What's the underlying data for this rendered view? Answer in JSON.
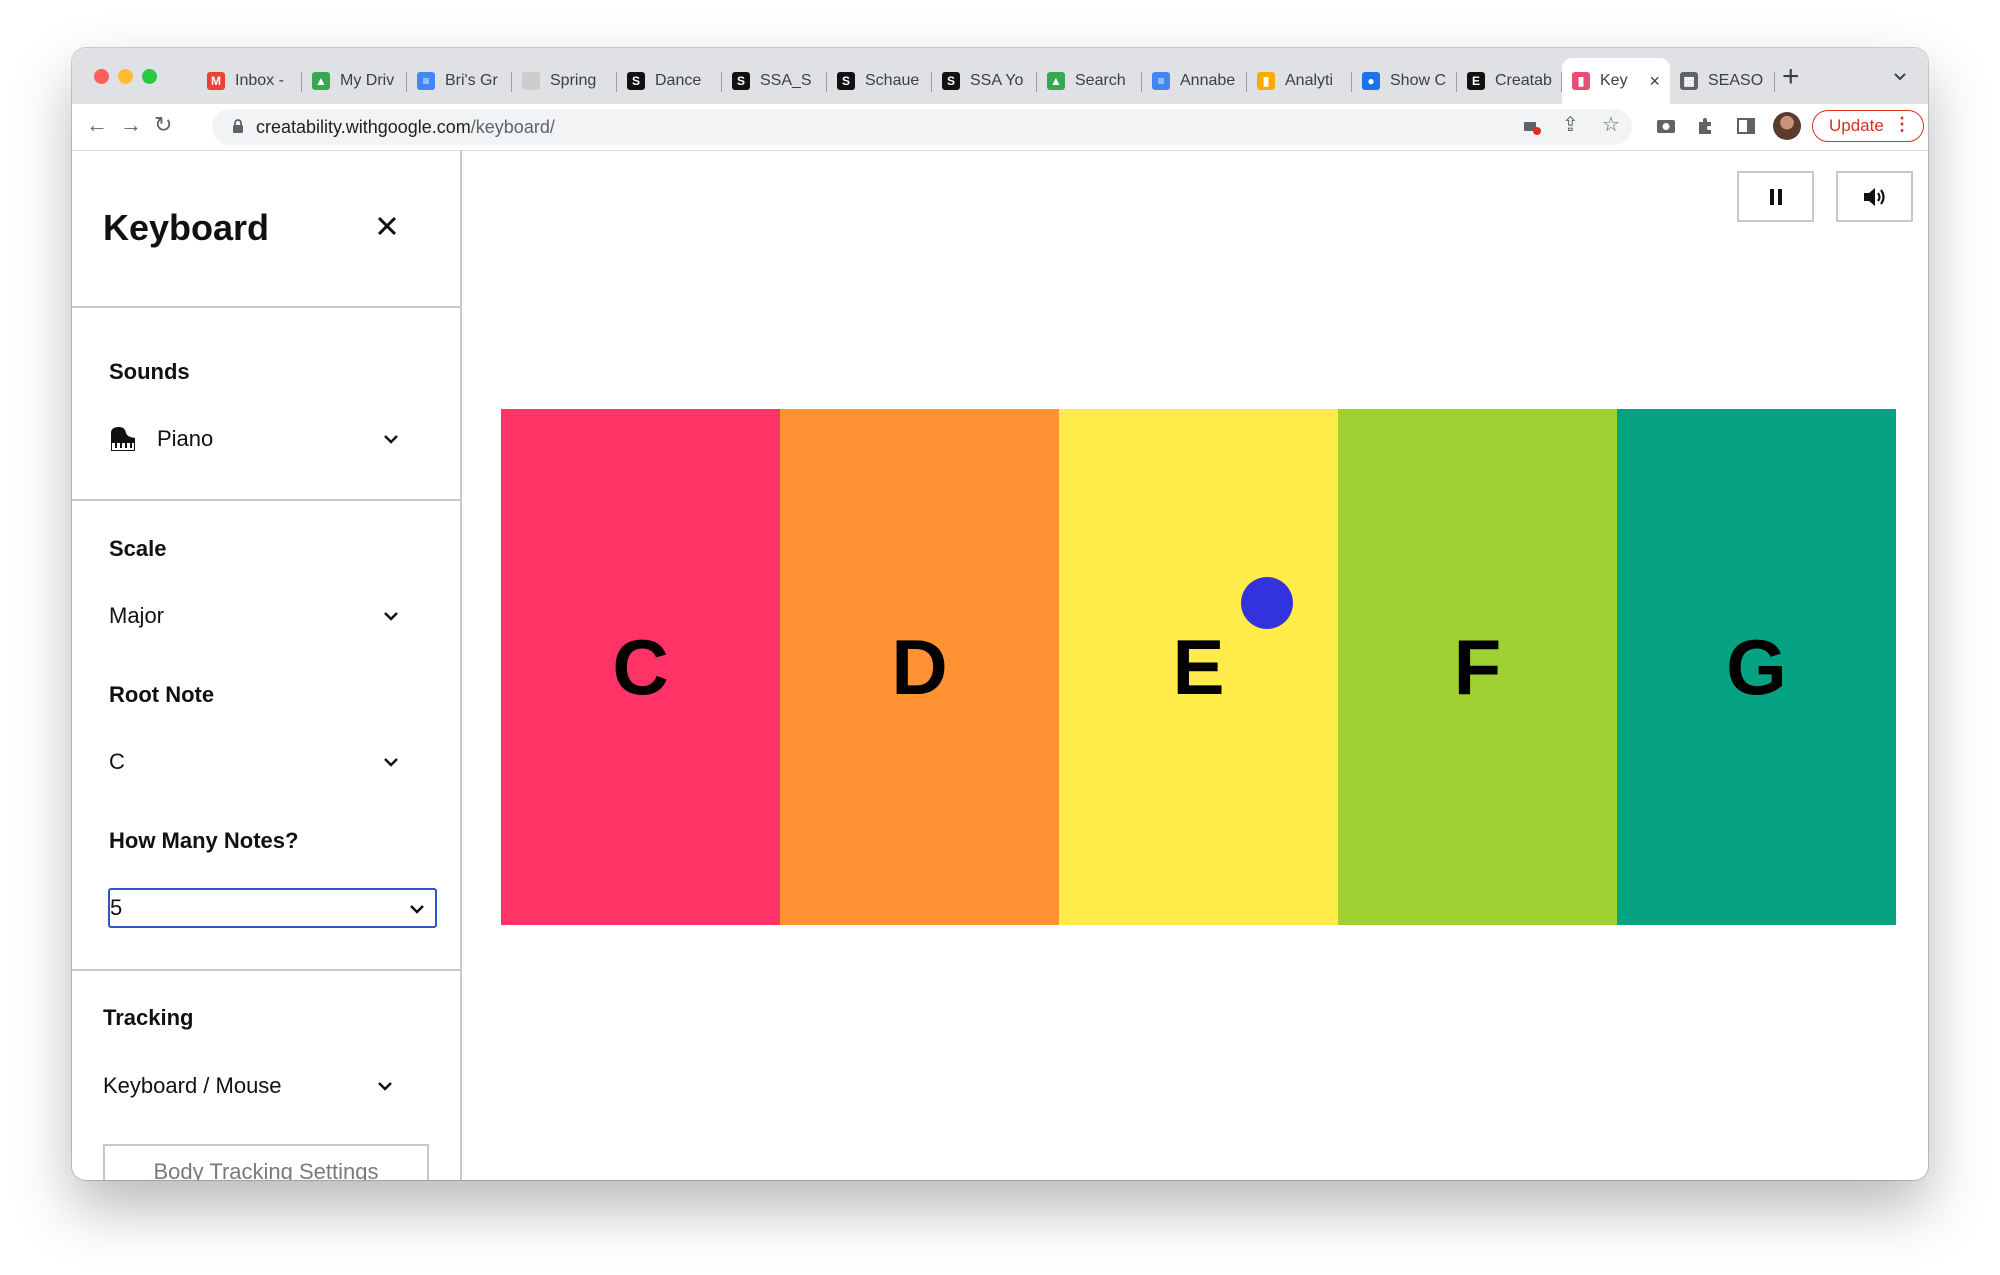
{
  "browser": {
    "tabs": [
      {
        "label": "Inbox -",
        "icon": "gmail-icon",
        "color": "#ea4335",
        "glyph": "M"
      },
      {
        "label": "My Driv",
        "icon": "drive-icon",
        "color": "#34a853",
        "glyph": "▲"
      },
      {
        "label": "Bri's Gr",
        "icon": "docs-icon",
        "color": "#4285f4",
        "glyph": "≡"
      },
      {
        "label": "Spring",
        "icon": "page-icon",
        "color": "#cccccc",
        "glyph": ""
      },
      {
        "label": "Dance",
        "icon": "ssa-icon",
        "color": "#111111",
        "glyph": "S"
      },
      {
        "label": "SSA_S",
        "icon": "ssa-icon",
        "color": "#111111",
        "glyph": "S"
      },
      {
        "label": "Schaue",
        "icon": "ssa-icon",
        "color": "#111111",
        "glyph": "S"
      },
      {
        "label": "SSA Yo",
        "icon": "ssa-icon",
        "color": "#111111",
        "glyph": "S"
      },
      {
        "label": "Search",
        "icon": "drive-icon",
        "color": "#34a853",
        "glyph": "▲"
      },
      {
        "label": "Annabe",
        "icon": "docs-icon",
        "color": "#4285f4",
        "glyph": "≡"
      },
      {
        "label": "Analyti",
        "icon": "analytics-icon",
        "color": "#f9ab00",
        "glyph": "▮"
      },
      {
        "label": "Show C",
        "icon": "globe-icon",
        "color": "#1a73e8",
        "glyph": "●"
      },
      {
        "label": "Creatab",
        "icon": "e-icon",
        "color": "#111111",
        "glyph": "E"
      },
      {
        "label": "Key",
        "icon": "creatability-icon",
        "color": "#e94e77",
        "glyph": "▮",
        "active": true
      },
      {
        "label": "SEASO",
        "icon": "image-icon",
        "color": "#5f6368",
        "glyph": "▦"
      }
    ],
    "url_host": "creatability.withgoogle.com",
    "url_path": "/keyboard/",
    "update_label": "Update"
  },
  "sidebar": {
    "title": "Keyboard",
    "sounds_label": "Sounds",
    "sounds_value": "Piano",
    "scale_label": "Scale",
    "scale_value": "Major",
    "root_label": "Root Note",
    "root_value": "C",
    "notes_label": "How Many Notes?",
    "notes_value": "5",
    "tracking_label": "Tracking",
    "tracking_value": "Keyboard / Mouse",
    "body_tracking_button": "Body Tracking Settings"
  },
  "keyboard": {
    "keys": [
      {
        "note": "C",
        "color": "#ff3366"
      },
      {
        "note": "D",
        "color": "#ff9233"
      },
      {
        "note": "E",
        "color": "#ffec4a"
      },
      {
        "note": "F",
        "color": "#a0d132"
      },
      {
        "note": "G",
        "color": "#06a383"
      }
    ],
    "cursor_color": "#3333dd"
  }
}
